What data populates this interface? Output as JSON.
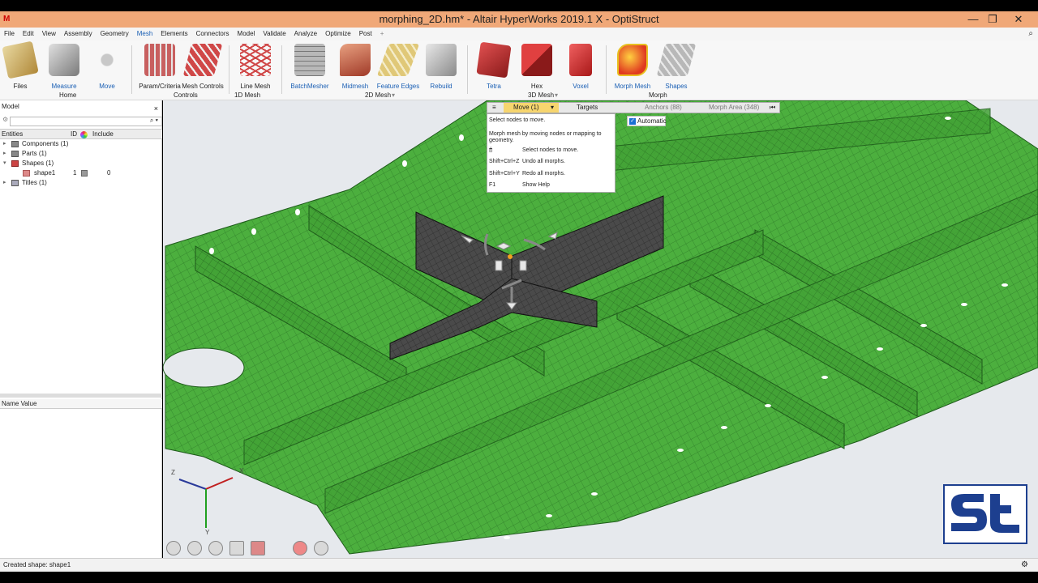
{
  "window": {
    "title": "morphing_2D.hm* - Altair HyperWorks 2019.1 X - OptiStruct",
    "minimize": "—",
    "restore": "❐",
    "close": "✕"
  },
  "menu": [
    "File",
    "Edit",
    "View",
    "Assembly",
    "Geometry",
    "Mesh",
    "Elements",
    "Connectors",
    "Model",
    "Validate",
    "Analyze",
    "Optimize",
    "Post",
    "+"
  ],
  "ribbon": {
    "tools": [
      {
        "label": "Files",
        "icon": "files-icon",
        "color": "#c8a860"
      },
      {
        "label": "Measure",
        "icon": "measure-icon",
        "color": "#9a9a9a"
      },
      {
        "label": "Move",
        "icon": "move-icon",
        "color": "#b0b0b0"
      },
      {
        "label": "Param/Criteria",
        "icon": "param-criteria-icon",
        "color": "#c86060"
      },
      {
        "label": "Mesh Controls",
        "icon": "mesh-controls-icon",
        "color": "#c84a4a"
      },
      {
        "label": "Line Mesh",
        "icon": "line-mesh-icon",
        "color": "#c84a4a"
      },
      {
        "label": "BatchMesher",
        "icon": "batchmesher-icon",
        "color": "#8a8a8a"
      },
      {
        "label": "Midmesh",
        "icon": "midmesh-icon",
        "color": "#c86a50"
      },
      {
        "label": "Feature Edges",
        "icon": "feature-edges-icon",
        "color": "#d8c070"
      },
      {
        "label": "Rebuild",
        "icon": "rebuild-icon",
        "color": "#b0b0b0"
      },
      {
        "label": "Tetra",
        "icon": "tetra-icon",
        "color": "#c83030"
      },
      {
        "label": "Hex",
        "icon": "hex-icon",
        "color": "#c83030"
      },
      {
        "label": "Voxel",
        "icon": "voxel-icon",
        "color": "#c83030"
      },
      {
        "label": "Morph Mesh",
        "icon": "morph-mesh-icon",
        "color": "#e03a20"
      },
      {
        "label": "Shapes",
        "icon": "shapes-icon",
        "color": "#a0a0a0"
      }
    ],
    "groups": [
      "Home",
      "Controls",
      "1D Mesh",
      "2D Mesh",
      "3D Mesh",
      "Morph"
    ]
  },
  "model_panel": {
    "title": "Model",
    "close": "×",
    "filter_placeholder": "",
    "columns": [
      "Entities",
      "ID",
      "Include"
    ],
    "tree": [
      {
        "label": "Components (1)"
      },
      {
        "label": "Parts (1)"
      },
      {
        "label": "Shapes (1)"
      },
      {
        "label": "shape1",
        "id": "1",
        "include": "0"
      },
      {
        "label": "Titles (1)"
      }
    ],
    "name_value_header": "Name Value"
  },
  "morph_toolbar": {
    "menu": "≡",
    "move": "Move (1)",
    "targets": "Targets",
    "anchors": "Anchors (88)",
    "morph_area": "Morph Area (348)",
    "collapse": "⏮",
    "automatic": "Automatic",
    "automatic_checked": true
  },
  "morph_tip": {
    "header": "Select nodes to move.",
    "description_line1": "Morph mesh by moving nodes or mapping to",
    "description_line2": "geometry.",
    "shortcuts": [
      {
        "key": "🖱",
        "action": "Select nodes to move."
      },
      {
        "key": "Shift+Ctrl+Z",
        "action": "Undo all morphs."
      },
      {
        "key": "Shift+Ctrl+Y",
        "action": "Redo all morphs."
      },
      {
        "key": "F1",
        "action": "Show Help"
      }
    ]
  },
  "triad": {
    "x": "X",
    "y": "Y",
    "z": "Z"
  },
  "status": "Created shape: shape1",
  "colors": {
    "mesh": "#4caf3e",
    "mesh_dark": "#2e7d28",
    "morph_region": "#4a4a4a",
    "titlebar": "#f0a878",
    "accent": "#1a5fb4"
  }
}
